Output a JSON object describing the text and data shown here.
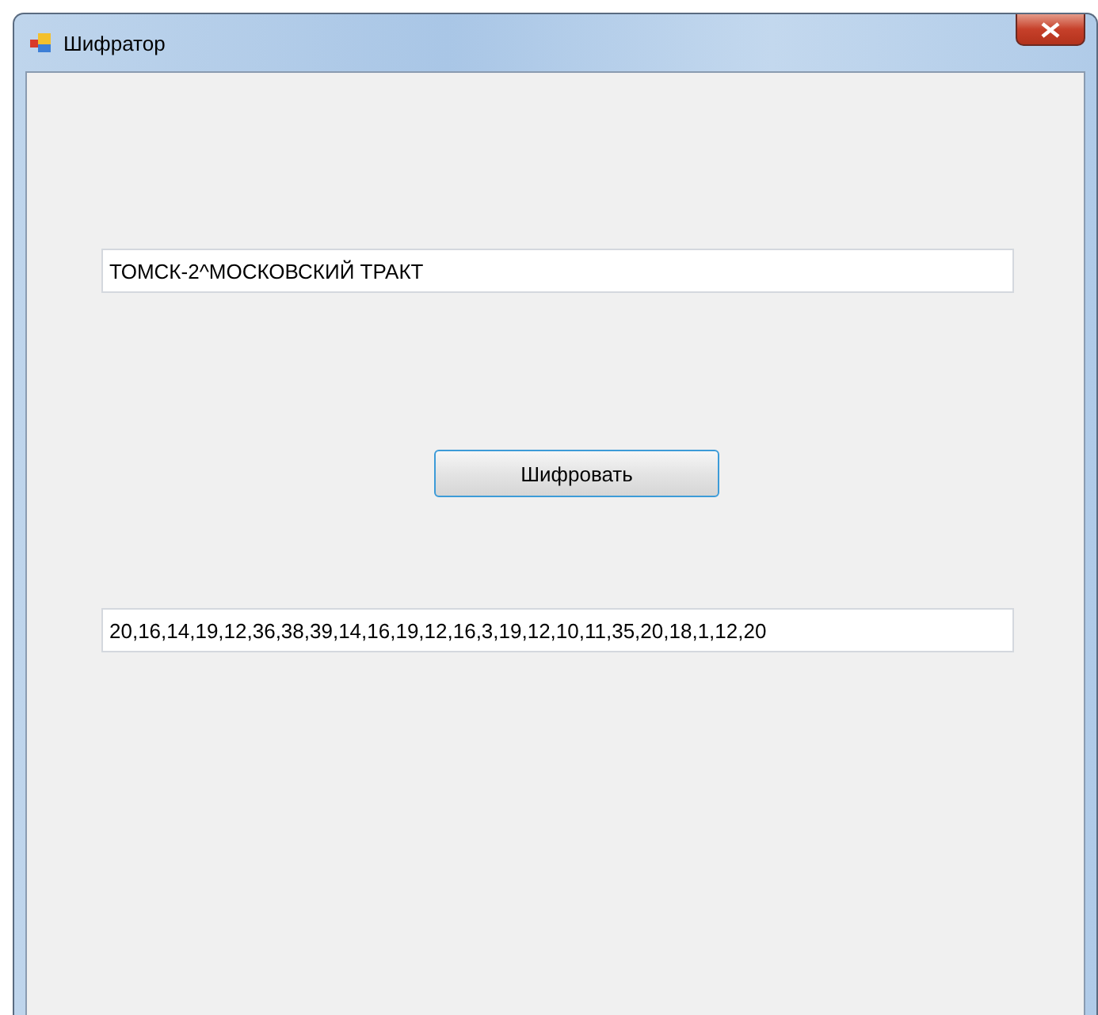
{
  "window": {
    "title": "Шифратор"
  },
  "input": {
    "value": "ТОМСК-2^МОСКОВСКИЙ ТРАКТ"
  },
  "button": {
    "label": "Шифровать"
  },
  "output": {
    "value": "20,16,14,19,12,36,38,39,14,16,19,12,16,3,19,12,10,11,35,20,18,1,12,20"
  }
}
